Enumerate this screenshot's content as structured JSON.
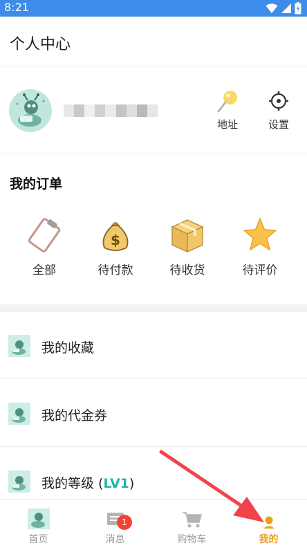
{
  "status_bar": {
    "time": "8:21"
  },
  "header": {
    "title": "个人中心"
  },
  "profile": {
    "address_label": "地址",
    "settings_label": "设置"
  },
  "orders": {
    "title": "我的订单",
    "items": [
      {
        "label": "全部",
        "icon": "clipboard-icon"
      },
      {
        "label": "待付款",
        "icon": "money-bag-icon"
      },
      {
        "label": "待收货",
        "icon": "package-icon"
      },
      {
        "label": "待评价",
        "icon": "star-icon"
      }
    ]
  },
  "menu": {
    "items": [
      {
        "label": "我的收藏"
      },
      {
        "label": "我的代金券"
      },
      {
        "label_prefix": "我的等级 (",
        "level": "LV1",
        "label_suffix": ")"
      }
    ]
  },
  "tabbar": {
    "tabs": [
      {
        "label": "首页"
      },
      {
        "label": "消息",
        "badge": "1"
      },
      {
        "label": "购物车"
      },
      {
        "label": "我的",
        "active": true
      }
    ]
  },
  "colors": {
    "status_bar": "#3e8ce9",
    "active_tab": "#f29a12",
    "badge": "#f44336",
    "level": "#22b5a9",
    "annotation_arrow": "#f0434b"
  }
}
